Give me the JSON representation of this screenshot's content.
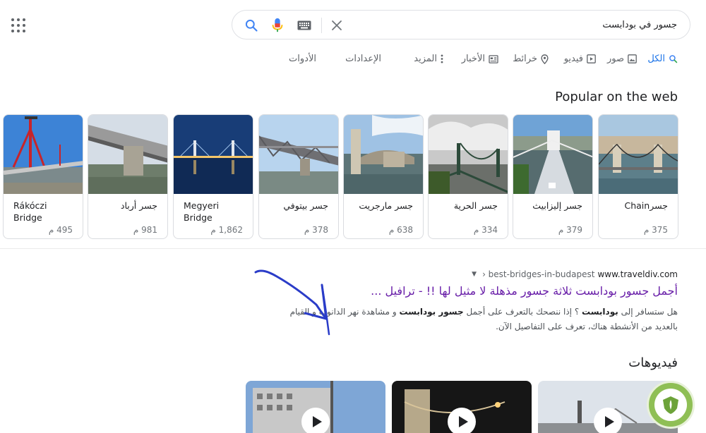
{
  "search": {
    "query": "جسور في بودابست"
  },
  "tabs": [
    {
      "label": "الكل",
      "icon": "search-icon",
      "active": true
    },
    {
      "label": "صور",
      "icon": "image-icon"
    },
    {
      "label": "فيديو",
      "icon": "video-icon"
    },
    {
      "label": "خرائط",
      "icon": "map-pin-icon"
    },
    {
      "label": "الأخبار",
      "icon": "news-icon"
    },
    {
      "label": "المزيد",
      "icon": "more-icon"
    },
    {
      "label": "الإعدادات"
    },
    {
      "label": "الأدوات"
    }
  ],
  "popular": {
    "title": "Popular on the web",
    "cards": [
      {
        "name": "جسرChain",
        "count": "375 م"
      },
      {
        "name": "جسر إليزابيث",
        "count": "379 م"
      },
      {
        "name": "جسر الحرية",
        "count": "334 م"
      },
      {
        "name": "جسر مارجريت",
        "count": "638 م"
      },
      {
        "name": "جسر بيتوفي",
        "count": "378 م"
      },
      {
        "name": "Megyeri Bridge",
        "count": "1,862 م"
      },
      {
        "name": "جسر أرباد",
        "count": "981 م"
      },
      {
        "name": "Rákóczi Bridge",
        "count": "495 م"
      }
    ]
  },
  "result": {
    "site": "www.traveldiv.com",
    "path": "› best-bridges-in-budapest",
    "title": "أجمل جسور بودابست ثلاثة جسور مذهلة لا مثيل لها !! - ترافيل ...",
    "snippet_parts": [
      {
        "text": "هل ستسافر إلى ",
        "bold": false
      },
      {
        "text": "بودابست",
        "bold": true
      },
      {
        "text": " ؟ إذا ننصحك بالتعرف على أجمل ",
        "bold": false
      },
      {
        "text": "جسور بودابست",
        "bold": true
      },
      {
        "text": " و مشاهدة نهر الدانوب و القيام بالعديد من الأنشطة هناك، تعرف على التفاصيل الآن.",
        "bold": false
      }
    ]
  },
  "videos": {
    "title": "فيديوهات"
  },
  "colors": {
    "accent": "#1a73e8",
    "visited": "#681da8",
    "annotation": "#2a3cc8"
  }
}
